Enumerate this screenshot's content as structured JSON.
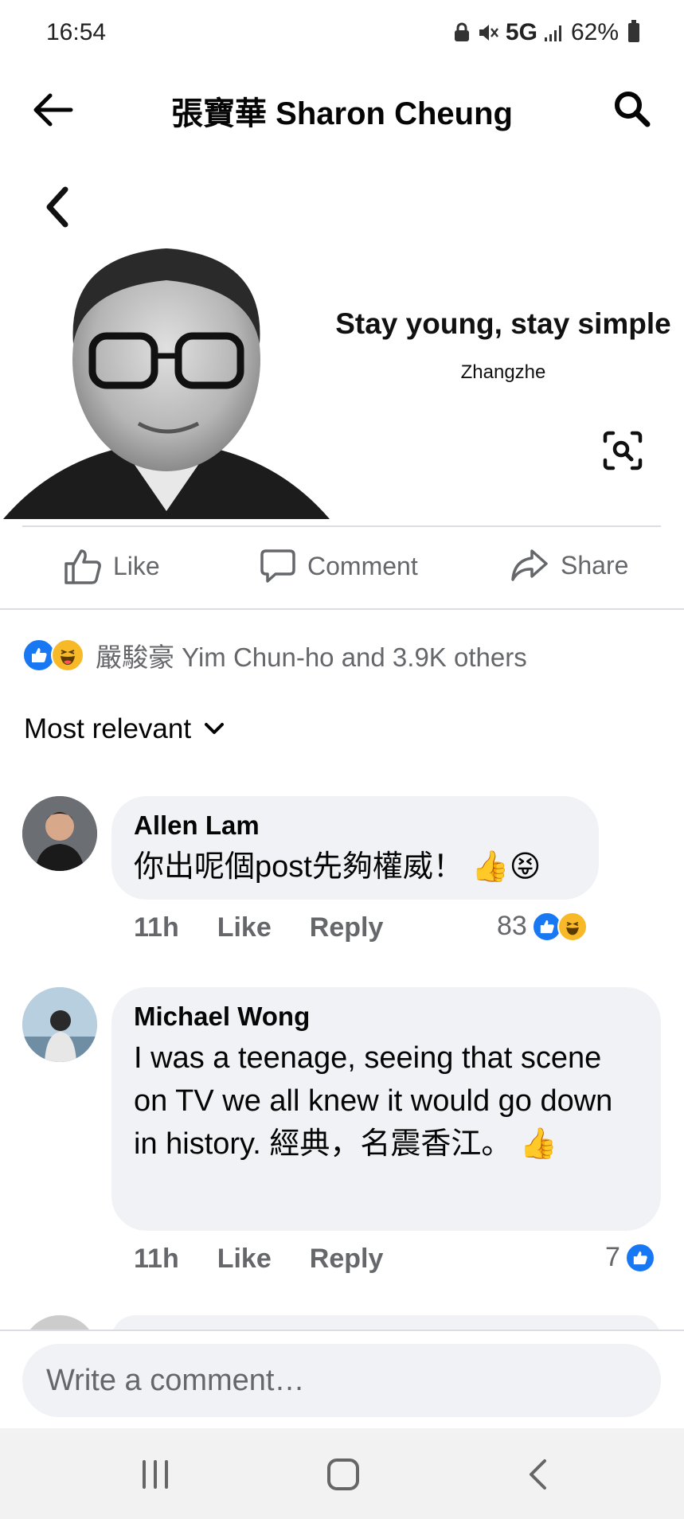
{
  "status_bar": {
    "time": "16:54",
    "network": "5G",
    "battery": "62%"
  },
  "header": {
    "title": "張寶華 Sharon Cheung"
  },
  "post_image": {
    "quote": "Stay young, stay simple",
    "author": "Zhangzhe"
  },
  "actions": {
    "like": "Like",
    "comment": "Comment",
    "share": "Share"
  },
  "reactions": {
    "summary": "嚴駿豪 Yim Chun-ho and 3.9K others"
  },
  "sort": {
    "label": "Most relevant"
  },
  "comments": [
    {
      "name": "Allen Lam",
      "text": "你出呢個post先夠權威！",
      "time": "11h",
      "like": "Like",
      "reply": "Reply",
      "count": "83"
    },
    {
      "name": "Michael Wong",
      "text": "I was a teenage, seeing that scene on TV we all knew it would go down in history. 經典，名震香江。",
      "time": "11h",
      "like": "Like",
      "reply": "Reply",
      "count": "7"
    }
  ],
  "composer": {
    "placeholder": "Write a comment…"
  },
  "colors": {
    "accent": "#1877f2",
    "haha": "#f7b928",
    "bubble": "#f0f2f5",
    "muted": "#65676b"
  }
}
